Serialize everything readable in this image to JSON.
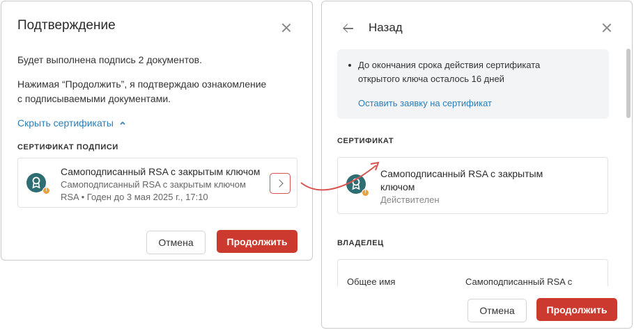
{
  "left_dialog": {
    "title": "Подтверждение",
    "line1": "Будет выполнена подпись 2 документов.",
    "line2a": "Нажимая “Продолжить”, я подтверждаю ознакомление",
    "line2b": "с подписываемыми документами.",
    "toggle_link": "Скрыть сертификаты",
    "section_label": "СЕРТИФИКАТ ПОДПИСИ",
    "cert": {
      "name": "Самоподписанный RSA с закрытым ключом",
      "issuer_line1": "Самоподписанный RSA с закрытым ключом",
      "issuer_line2": "RSA • Годен до 3 мая 2025 г., 17:10"
    },
    "cancel_label": "Отмена",
    "continue_label": "Продолжить"
  },
  "right_dialog": {
    "back_label": "Назад",
    "notice_text1": "До окончания срока действия сертификата",
    "notice_text2": "открытого ключа осталось 16 дней",
    "notice_link": "Оставить заявку на сертификат",
    "cert_section_label": "СЕРТИФИКАТ",
    "cert": {
      "name_line1": "Самоподписанный RSA с закрытым",
      "name_line2": "ключом",
      "status": "Действителен"
    },
    "owner_section_label": "ВЛАДЕЛЕЦ",
    "owner": {
      "field_label": "Общее имя",
      "field_value": "Самоподписанный RSA с"
    },
    "cancel_label": "Отмена",
    "continue_label": "Продолжить"
  },
  "colors": {
    "primary": "#cc3a2f",
    "link": "#2a7fb8",
    "cert_icon": "#2e6e73",
    "badge": "#e8a23c",
    "arrow": "#d9534f"
  }
}
